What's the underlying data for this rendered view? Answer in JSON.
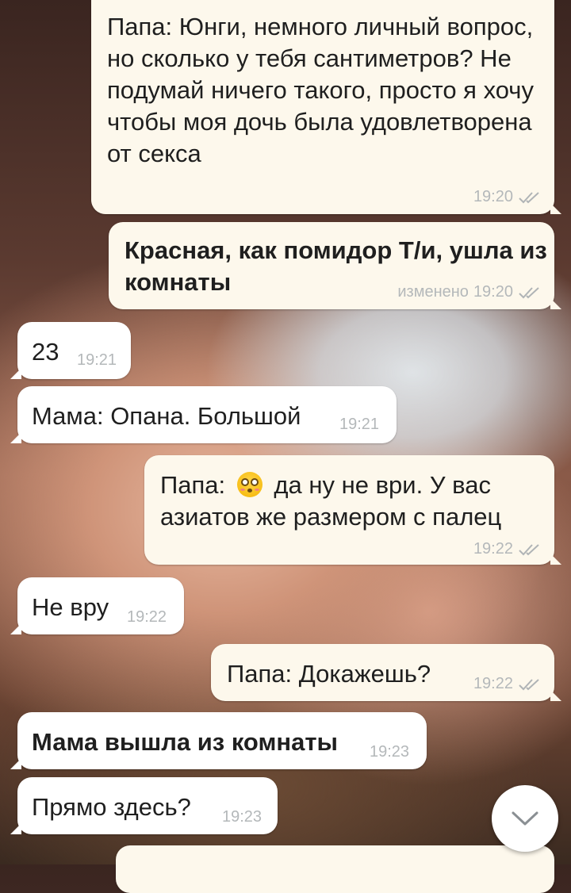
{
  "messages": [
    {
      "text": "Папа: Юнги, немного личный вопрос, но сколько у тебя сантиметров? Не подумай ничего такого, просто я хочу чтобы моя дочь была удовлетворена от секса",
      "time": "19:20"
    },
    {
      "text": "Красная, как помидор Т/и, ушла из комнаты",
      "edited_label": "изменено",
      "time": "19:20"
    },
    {
      "text": "23",
      "time": "19:21"
    },
    {
      "text": "Мама: Опана. Большой",
      "time": "19:21"
    },
    {
      "text_before": "Папа:",
      "emoji": "flushed-face",
      "text_after": "да ну не ври. У вас азиатов же размером с палец",
      "time": "19:22"
    },
    {
      "text": "Не вру",
      "time": "19:22"
    },
    {
      "text": "Папа: Докажешь?",
      "time": "19:22"
    },
    {
      "text": "Мама вышла из комнаты",
      "time": "19:23"
    },
    {
      "text": "Прямо здесь?",
      "time": "19:23"
    }
  ],
  "colors": {
    "outgoing_bubble": "#fdf8ec",
    "incoming_bubble": "#ffffff",
    "read_ticks": "#b0b4b6",
    "timestamp": "#b4b8ba"
  },
  "icons": {
    "read_status": "double-check-icon",
    "scroll_down": "chevron-down-icon"
  }
}
